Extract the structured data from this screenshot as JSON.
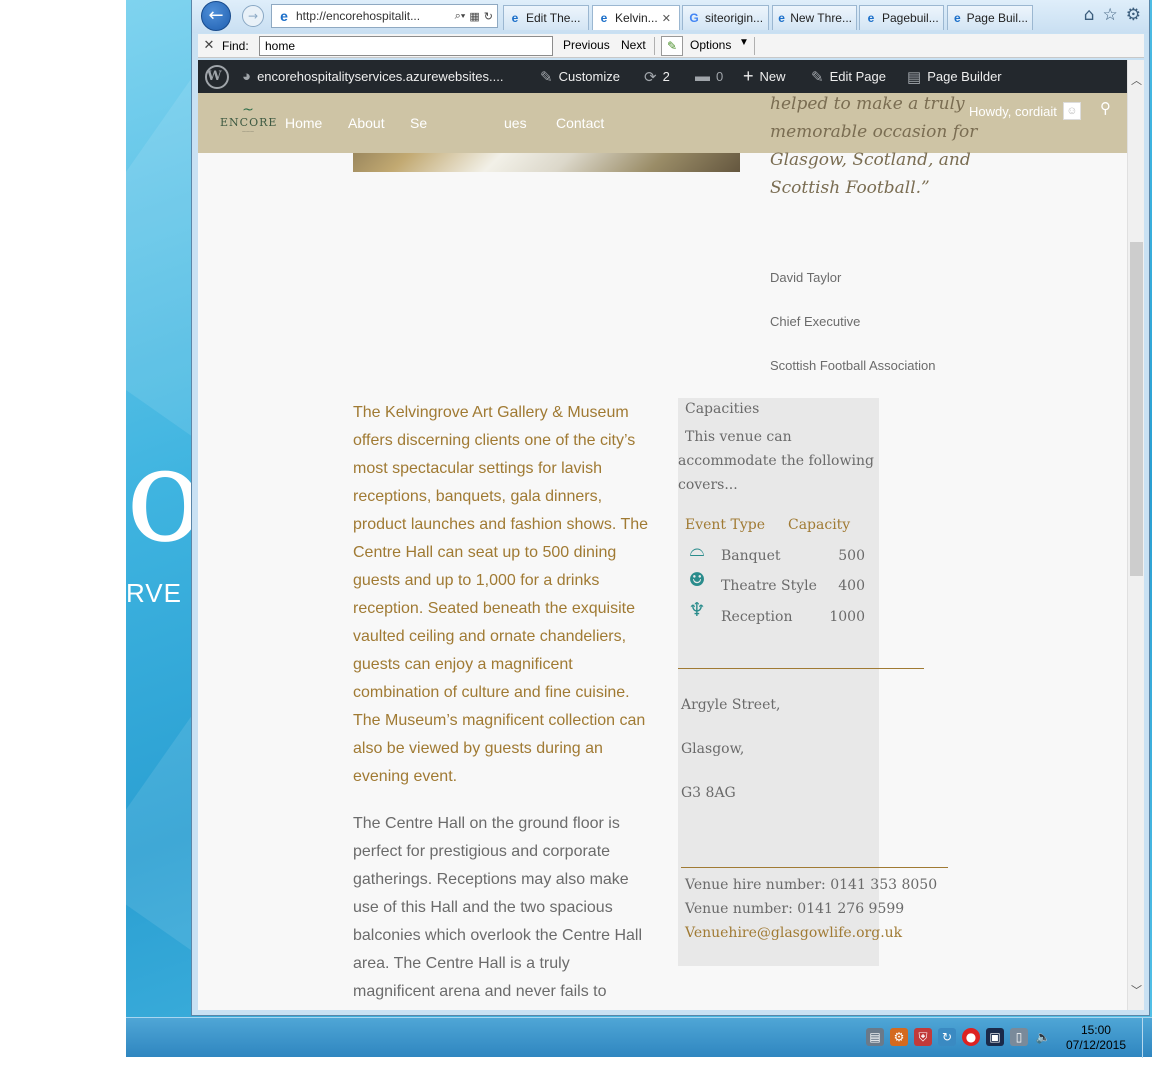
{
  "desktop": {
    "text_large": "or",
    "text_small": "RVE"
  },
  "browser": {
    "address_url": "http://encorehospitalit...",
    "tabs": [
      {
        "label": "Edit The...",
        "icon": "ie-icon"
      },
      {
        "label": "Kelvin...",
        "icon": "ie-icon",
        "active": true
      },
      {
        "label": "siteorigin...",
        "icon": "google-icon"
      },
      {
        "label": "New Thre...",
        "icon": "ie-icon"
      },
      {
        "label": "Pagebuil...",
        "icon": "ie-icon"
      },
      {
        "label": "Page Buil...",
        "icon": "ie-icon"
      }
    ]
  },
  "findbar": {
    "label": "Find:",
    "value": "home",
    "previous": "Previous",
    "next": "Next",
    "options": "Options"
  },
  "wpbar": {
    "site": "encorehospitalityservices.azurewebsites....",
    "customize": "Customize",
    "updates": "2",
    "comments": "0",
    "new": "New",
    "edit_page": "Edit Page",
    "page_builder": "Page Builder"
  },
  "site_header": {
    "logo_word": "ENCORE",
    "menu": [
      "Home",
      "About",
      "Se",
      "ues",
      "Contact"
    ],
    "howdy": "Howdy, cordiait"
  },
  "testimonial": {
    "quote": "helped to make a truly memorable occasion for Glasgow, Scotland, and Scottish Football.”",
    "name": "David Taylor",
    "role": "Chief Executive",
    "org": "Scottish Football Association"
  },
  "body": {
    "paragraph1": "The Kelvingrove Art Gallery & Museum offers discerning clients one of the city’s most spectacular settings for lavish receptions, banquets, gala dinners, product launches and fashion shows. The Centre Hall can seat up to 500 dining guests and up to 1,000 for a drinks reception. Seated beneath the exquisite vaulted ceiling and ornate chandeliers, guests can enjoy a magnificent combination of culture and fine cuisine. The Museum’s magnificent collection can also be viewed by guests during an evening event.",
    "paragraph2": "The Centre Hall on the ground floor is perfect for prestigious and corporate gatherings. Receptions may also make use of this Hall and the two spacious balconies which overlook the Centre Hall area. The Centre Hall is a truly magnificent arena and never fails to"
  },
  "capacities": {
    "title": "Capacities",
    "description": "This venue can accommodate the following covers...",
    "col_type": "Event Type",
    "col_capacity": "Capacity",
    "rows": [
      {
        "type": "Banquet",
        "capacity": "500",
        "icon": "cloche-icon"
      },
      {
        "type": "Theatre Style",
        "capacity": "400",
        "icon": "theatre-masks-icon"
      },
      {
        "type": "Reception",
        "capacity": "1000",
        "icon": "wine-glass-icon"
      }
    ],
    "address": [
      "Argyle Street,",
      "Glasgow,",
      "G3 8AG"
    ],
    "venue_hire": "Venue hire number: 0141 353 8050",
    "venue_number": "Venue number: 0141 276 9599",
    "email": "Venuehire@glasgowlife.org.uk"
  },
  "taskbar": {
    "time": "15:00",
    "date": "07/12/2015"
  },
  "colors": {
    "accent_gold": "#a07a33",
    "header_tan": "#cec4a5",
    "wpbar": "#23282d",
    "teal_icon": "#2a8c8c"
  }
}
